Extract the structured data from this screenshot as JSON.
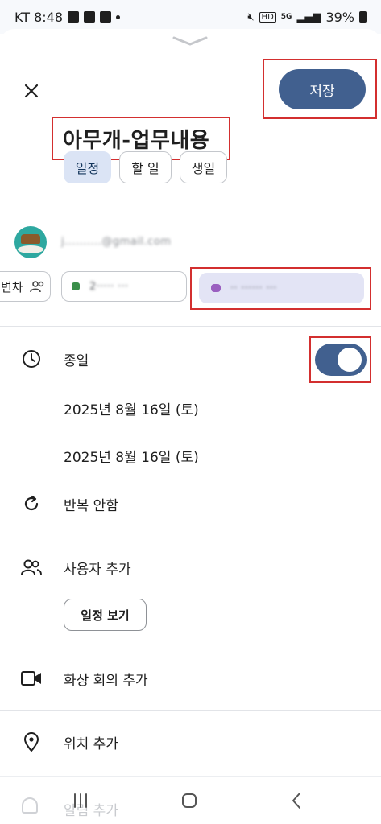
{
  "status_bar": {
    "carrier_time": "KT 8:48",
    "network": "5G",
    "battery": "39%"
  },
  "header": {
    "save_label": "저장",
    "title": "아무개-업무내용"
  },
  "type_tabs": [
    {
      "label": "일정",
      "selected": true
    },
    {
      "label": "할 일",
      "selected": false
    },
    {
      "label": "생일",
      "selected": false
    }
  ],
  "account": {
    "email": "j..........@gmail.com"
  },
  "calendars": {
    "partial_chip_label": "변차",
    "chip_2_label": "2····· ···",
    "chip_3_label": "·· ······ ···"
  },
  "all_day": {
    "label": "종일",
    "enabled": true
  },
  "dates": {
    "start": "2025년 8월 16일 (토)",
    "end": "2025년 8월 16일 (토)"
  },
  "repeat": {
    "label": "반복 안함"
  },
  "guests": {
    "label": "사용자 추가",
    "view_schedule_label": "일정 보기"
  },
  "video": {
    "label": "화상 회의 추가"
  },
  "location": {
    "label": "위치 추가"
  },
  "notification": {
    "label": "알림 추가"
  },
  "colors": {
    "accent": "#41608f",
    "selected_chip": "#dbe4f5",
    "highlight_box": "#d32f2f"
  }
}
